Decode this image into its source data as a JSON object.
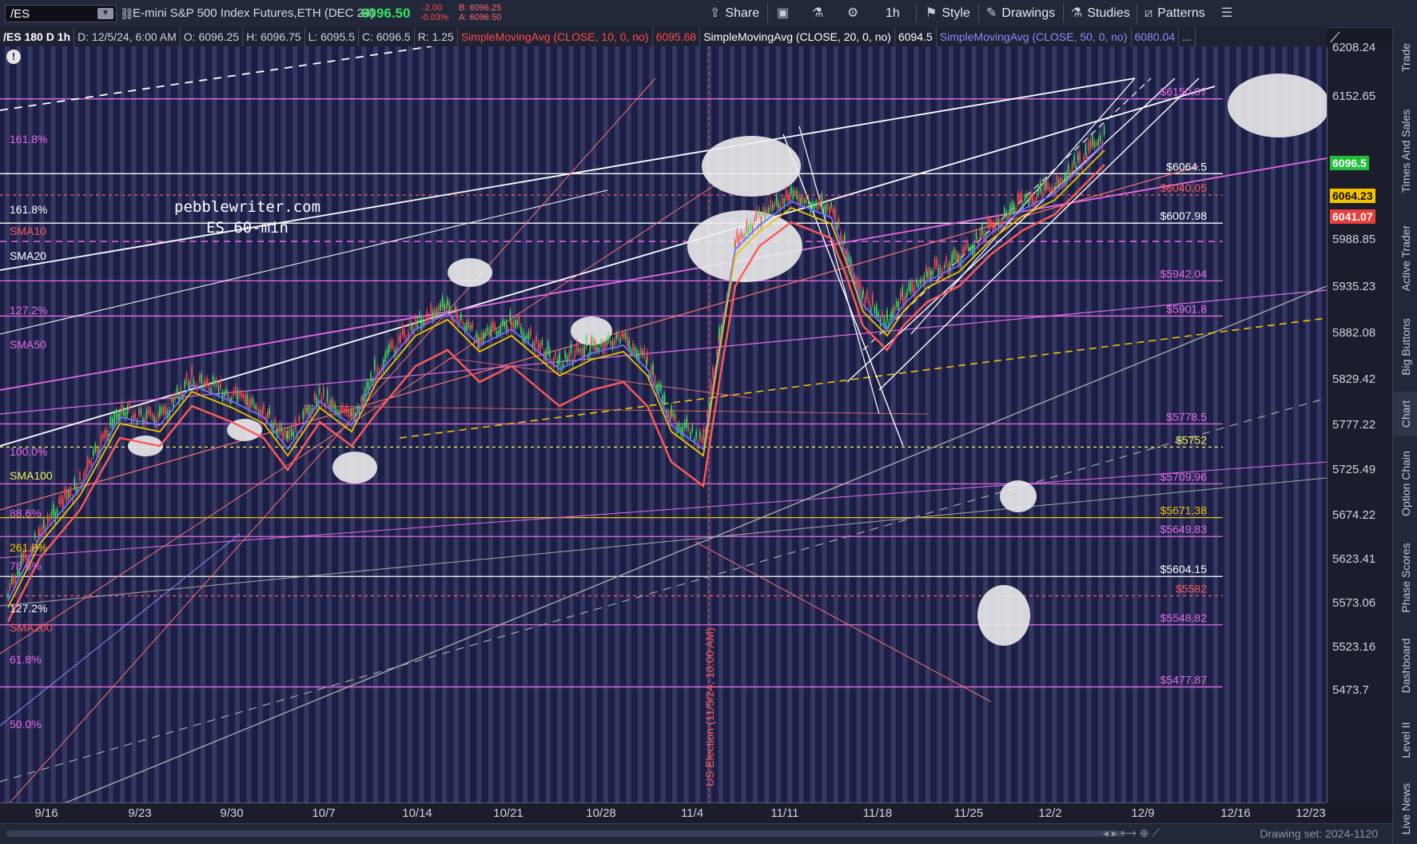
{
  "toolbar": {
    "symbol": "/ES",
    "description": "E-mini S&P 500 Index Futures,ETH (DEC 24)",
    "last_price": "6096.50",
    "net_change": "-2.00",
    "pct_change": "-0.03%",
    "bid": "B: 6096.25",
    "ask": "A: 6096.50",
    "share_label": "Share",
    "timeframe": "1h",
    "style_label": "Style",
    "drawings_label": "Drawings",
    "studies_label": "Studies",
    "patterns_label": "Patterns"
  },
  "study_header": {
    "chart_id": "/ES 180 D 1h",
    "date": "D: 12/5/24, 6:00 AM",
    "open": "O: 6096.25",
    "high": "H: 6096.75",
    "low": "L: 6095.5",
    "close": "C: 6096.5",
    "range": "R: 1.25",
    "sma10_label": "SimpleMovingAvg (CLOSE, 10, 0, no)",
    "sma10_value": "6095.68",
    "sma20_label": "SimpleMovingAvg (CLOSE, 20, 0, no)",
    "sma20_value": "6094.5",
    "sma50_label": "SimpleMovingAvg (CLOSE, 50, 0, no)",
    "sma50_value": "6080.04",
    "more": "..."
  },
  "chart": {
    "watermark_site": "pebblewriter.com",
    "watermark_label": "ES 60-min",
    "event_label": "US Election (11/5/24, 10:00 AM)",
    "price_ticks": [
      "6208.24",
      "6152.65",
      "5988.85",
      "5935.23",
      "5882.08",
      "5829.42",
      "5777.22",
      "5725.49",
      "5674.22",
      "5623.41",
      "5573.06",
      "5523.16",
      "5473.7"
    ],
    "price_boxes": [
      {
        "value": "6096.5",
        "bg": "#1fbf3b",
        "fg": "#ffffff"
      },
      {
        "value": "6064.23",
        "bg": "#f2c300",
        "fg": "#111111"
      },
      {
        "value": "6041.07",
        "bg": "#e8403a",
        "fg": "#ffffff"
      }
    ],
    "time_ticks": [
      "9/16",
      "9/23",
      "9/30",
      "10/7",
      "10/14",
      "10/21",
      "10/28",
      "11/4",
      "11/11",
      "11/18",
      "11/25",
      "12/2",
      "12/9",
      "12/16",
      "12/23"
    ],
    "left_labels": [
      {
        "text": "161.8%",
        "color": "#e86be8"
      },
      {
        "text": "161.8%",
        "color": "#ffffff"
      },
      {
        "text": "SMA10",
        "color": "#ff5a5a"
      },
      {
        "text": "SMA20",
        "color": "#ffffff"
      },
      {
        "text": "127.2%",
        "color": "#e86be8"
      },
      {
        "text": "SMA50",
        "color": "#e86be8"
      },
      {
        "text": "100.0%",
        "color": "#e86be8"
      },
      {
        "text": "SMA100",
        "color": "#f2f25a"
      },
      {
        "text": "88.6%",
        "color": "#e86be8"
      },
      {
        "text": "261.8%",
        "color": "#f2c300"
      },
      {
        "text": "78.6%",
        "color": "#e86be8"
      },
      {
        "text": "127.2%",
        "color": "#ffffff"
      },
      {
        "text": "SMA200",
        "color": "#ff5a5a"
      },
      {
        "text": "61.8%",
        "color": "#e86be8"
      },
      {
        "text": "50.0%",
        "color": "#e86be8"
      }
    ],
    "right_labels": [
      {
        "text": "$6150.07",
        "color": "#e86be8"
      },
      {
        "text": "$6064.5",
        "color": "#ffffff"
      },
      {
        "text": "$6040.05",
        "color": "#ff5a5a"
      },
      {
        "text": "$6007.98",
        "color": "#ffffff"
      },
      {
        "text": "$5942.04",
        "color": "#e86be8"
      },
      {
        "text": "$5901.8",
        "color": "#e86be8"
      },
      {
        "text": "$5778.5",
        "color": "#e86be8"
      },
      {
        "text": "$5752",
        "color": "#f2f25a"
      },
      {
        "text": "$5709.96",
        "color": "#e86be8"
      },
      {
        "text": "$5671.38",
        "color": "#f2c300"
      },
      {
        "text": "$5649.83",
        "color": "#e86be8"
      },
      {
        "text": "$5604.15",
        "color": "#ffffff"
      },
      {
        "text": "$5582",
        "color": "#ff5a5a"
      },
      {
        "text": "$5548.82",
        "color": "#e86be8"
      },
      {
        "text": "$5477.87",
        "color": "#e86be8"
      }
    ]
  },
  "sidebar": {
    "tabs": [
      "Trade",
      "Times And Sales",
      "Active Trader",
      "Big Buttons",
      "Chart",
      "Option Chain",
      "Phase Scores",
      "Dashboard",
      "Level II",
      "Live News"
    ]
  },
  "bottom": {
    "drawing_set": "Drawing set: 2024-1120"
  }
}
